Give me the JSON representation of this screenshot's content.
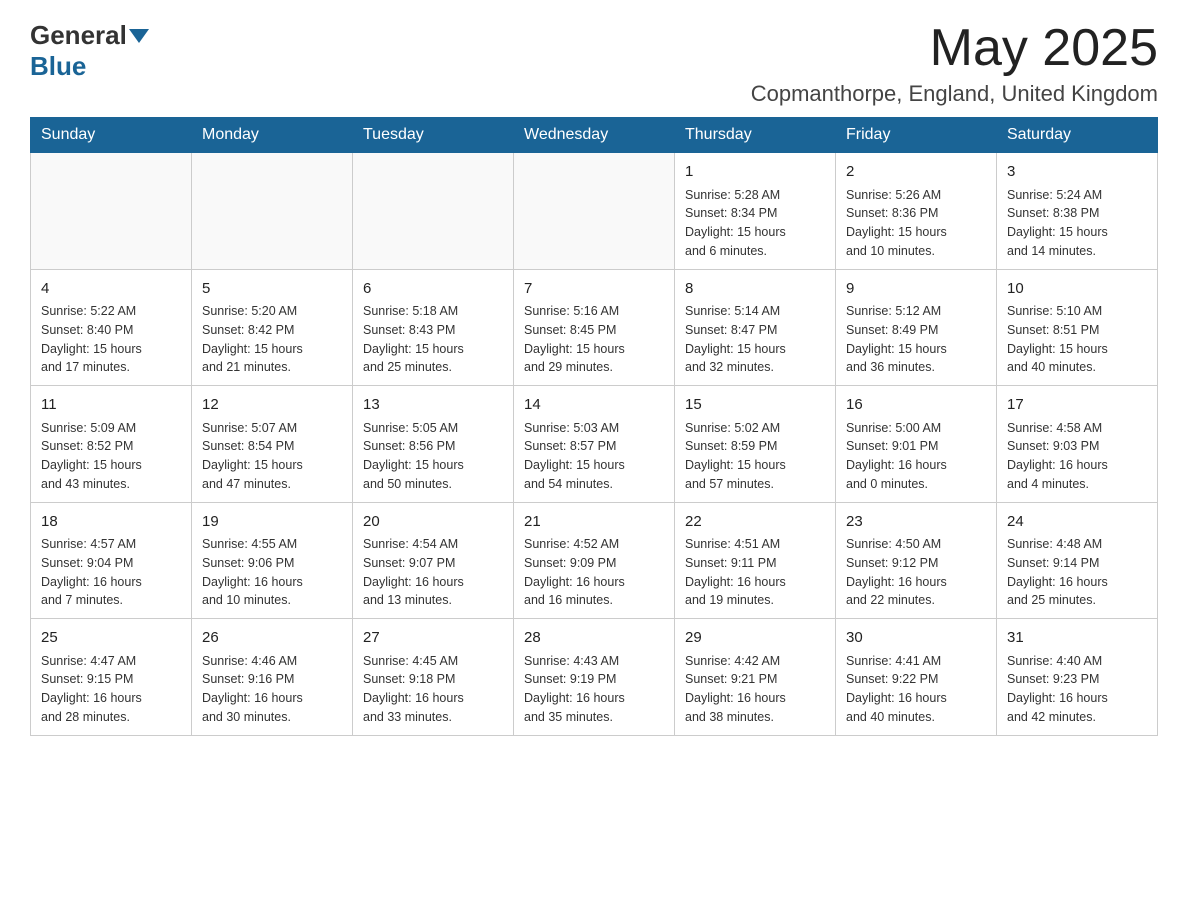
{
  "header": {
    "logo_general": "General",
    "logo_blue": "Blue",
    "month_title": "May 2025",
    "location": "Copmanthorpe, England, United Kingdom"
  },
  "days_of_week": [
    "Sunday",
    "Monday",
    "Tuesday",
    "Wednesday",
    "Thursday",
    "Friday",
    "Saturday"
  ],
  "weeks": [
    [
      {
        "day": "",
        "info": ""
      },
      {
        "day": "",
        "info": ""
      },
      {
        "day": "",
        "info": ""
      },
      {
        "day": "",
        "info": ""
      },
      {
        "day": "1",
        "info": "Sunrise: 5:28 AM\nSunset: 8:34 PM\nDaylight: 15 hours\nand 6 minutes."
      },
      {
        "day": "2",
        "info": "Sunrise: 5:26 AM\nSunset: 8:36 PM\nDaylight: 15 hours\nand 10 minutes."
      },
      {
        "day": "3",
        "info": "Sunrise: 5:24 AM\nSunset: 8:38 PM\nDaylight: 15 hours\nand 14 minutes."
      }
    ],
    [
      {
        "day": "4",
        "info": "Sunrise: 5:22 AM\nSunset: 8:40 PM\nDaylight: 15 hours\nand 17 minutes."
      },
      {
        "day": "5",
        "info": "Sunrise: 5:20 AM\nSunset: 8:42 PM\nDaylight: 15 hours\nand 21 minutes."
      },
      {
        "day": "6",
        "info": "Sunrise: 5:18 AM\nSunset: 8:43 PM\nDaylight: 15 hours\nand 25 minutes."
      },
      {
        "day": "7",
        "info": "Sunrise: 5:16 AM\nSunset: 8:45 PM\nDaylight: 15 hours\nand 29 minutes."
      },
      {
        "day": "8",
        "info": "Sunrise: 5:14 AM\nSunset: 8:47 PM\nDaylight: 15 hours\nand 32 minutes."
      },
      {
        "day": "9",
        "info": "Sunrise: 5:12 AM\nSunset: 8:49 PM\nDaylight: 15 hours\nand 36 minutes."
      },
      {
        "day": "10",
        "info": "Sunrise: 5:10 AM\nSunset: 8:51 PM\nDaylight: 15 hours\nand 40 minutes."
      }
    ],
    [
      {
        "day": "11",
        "info": "Sunrise: 5:09 AM\nSunset: 8:52 PM\nDaylight: 15 hours\nand 43 minutes."
      },
      {
        "day": "12",
        "info": "Sunrise: 5:07 AM\nSunset: 8:54 PM\nDaylight: 15 hours\nand 47 minutes."
      },
      {
        "day": "13",
        "info": "Sunrise: 5:05 AM\nSunset: 8:56 PM\nDaylight: 15 hours\nand 50 minutes."
      },
      {
        "day": "14",
        "info": "Sunrise: 5:03 AM\nSunset: 8:57 PM\nDaylight: 15 hours\nand 54 minutes."
      },
      {
        "day": "15",
        "info": "Sunrise: 5:02 AM\nSunset: 8:59 PM\nDaylight: 15 hours\nand 57 minutes."
      },
      {
        "day": "16",
        "info": "Sunrise: 5:00 AM\nSunset: 9:01 PM\nDaylight: 16 hours\nand 0 minutes."
      },
      {
        "day": "17",
        "info": "Sunrise: 4:58 AM\nSunset: 9:03 PM\nDaylight: 16 hours\nand 4 minutes."
      }
    ],
    [
      {
        "day": "18",
        "info": "Sunrise: 4:57 AM\nSunset: 9:04 PM\nDaylight: 16 hours\nand 7 minutes."
      },
      {
        "day": "19",
        "info": "Sunrise: 4:55 AM\nSunset: 9:06 PM\nDaylight: 16 hours\nand 10 minutes."
      },
      {
        "day": "20",
        "info": "Sunrise: 4:54 AM\nSunset: 9:07 PM\nDaylight: 16 hours\nand 13 minutes."
      },
      {
        "day": "21",
        "info": "Sunrise: 4:52 AM\nSunset: 9:09 PM\nDaylight: 16 hours\nand 16 minutes."
      },
      {
        "day": "22",
        "info": "Sunrise: 4:51 AM\nSunset: 9:11 PM\nDaylight: 16 hours\nand 19 minutes."
      },
      {
        "day": "23",
        "info": "Sunrise: 4:50 AM\nSunset: 9:12 PM\nDaylight: 16 hours\nand 22 minutes."
      },
      {
        "day": "24",
        "info": "Sunrise: 4:48 AM\nSunset: 9:14 PM\nDaylight: 16 hours\nand 25 minutes."
      }
    ],
    [
      {
        "day": "25",
        "info": "Sunrise: 4:47 AM\nSunset: 9:15 PM\nDaylight: 16 hours\nand 28 minutes."
      },
      {
        "day": "26",
        "info": "Sunrise: 4:46 AM\nSunset: 9:16 PM\nDaylight: 16 hours\nand 30 minutes."
      },
      {
        "day": "27",
        "info": "Sunrise: 4:45 AM\nSunset: 9:18 PM\nDaylight: 16 hours\nand 33 minutes."
      },
      {
        "day": "28",
        "info": "Sunrise: 4:43 AM\nSunset: 9:19 PM\nDaylight: 16 hours\nand 35 minutes."
      },
      {
        "day": "29",
        "info": "Sunrise: 4:42 AM\nSunset: 9:21 PM\nDaylight: 16 hours\nand 38 minutes."
      },
      {
        "day": "30",
        "info": "Sunrise: 4:41 AM\nSunset: 9:22 PM\nDaylight: 16 hours\nand 40 minutes."
      },
      {
        "day": "31",
        "info": "Sunrise: 4:40 AM\nSunset: 9:23 PM\nDaylight: 16 hours\nand 42 minutes."
      }
    ]
  ]
}
